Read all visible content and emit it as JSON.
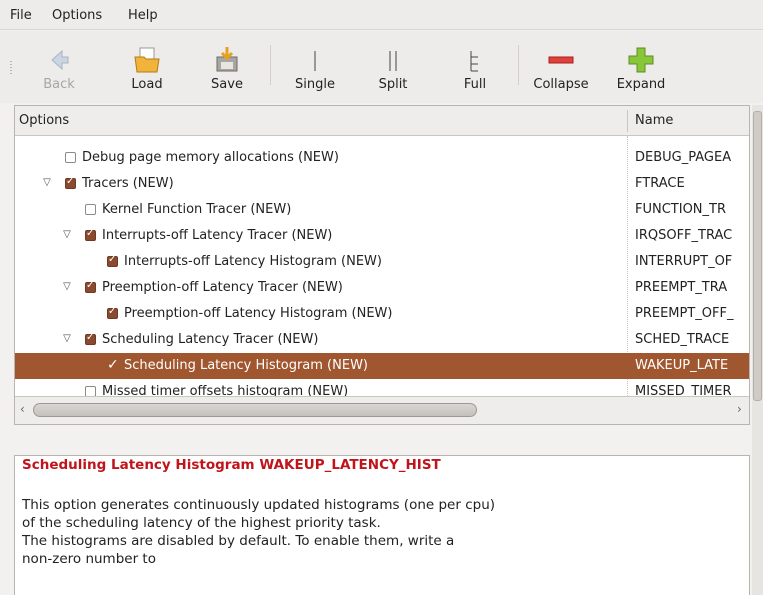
{
  "menu": {
    "file": "File",
    "options": "Options",
    "help": "Help"
  },
  "toolbar": {
    "back": "Back",
    "load": "Load",
    "save": "Save",
    "single": "Single",
    "split": "Split",
    "full": "Full",
    "collapse": "Collapse",
    "expand": "Expand"
  },
  "tree": {
    "headers": {
      "options": "Options",
      "name": "Name"
    },
    "rows": [
      {
        "label": "Debug page memory allocations (NEW)",
        "name": "DEBUG_PAGEA",
        "checked": false,
        "expander": ""
      },
      {
        "label": "Tracers (NEW)",
        "name": "FTRACE",
        "checked": true,
        "expander": "▽"
      },
      {
        "label": "Kernel Function Tracer (NEW)",
        "name": "FUNCTION_TR",
        "checked": false,
        "expander": ""
      },
      {
        "label": "Interrupts-off Latency Tracer (NEW)",
        "name": "IRQSOFF_TRAC",
        "checked": true,
        "expander": "▽"
      },
      {
        "label": "Interrupts-off Latency Histogram (NEW)",
        "name": "INTERRUPT_OF",
        "checked": true,
        "expander": ""
      },
      {
        "label": "Preemption-off Latency Tracer (NEW)",
        "name": "PREEMPT_TRA",
        "checked": true,
        "expander": "▽"
      },
      {
        "label": "Preemption-off Latency Histogram (NEW)",
        "name": "PREEMPT_OFF_",
        "checked": true,
        "expander": ""
      },
      {
        "label": "Scheduling Latency Tracer (NEW)",
        "name": "SCHED_TRACE",
        "checked": true,
        "expander": "▽"
      },
      {
        "label": "Scheduling Latency Histogram (NEW)",
        "name": "WAKEUP_LATE",
        "checked": true,
        "expander": "",
        "selected": true
      },
      {
        "label": "Missed timer offsets histogram (NEW)",
        "name": "MISSED_TIMER",
        "checked": false,
        "expander": ""
      }
    ]
  },
  "description": {
    "title": "Scheduling Latency Histogram WAKEUP_LATENCY_HIST",
    "lines": [
      "This option generates continuously updated histograms (one per cpu)",
      "of the scheduling latency of the highest priority task.",
      "The histograms are disabled by default. To enable them, write a",
      "non-zero number to"
    ]
  },
  "colors": {
    "selection": "#a0562e",
    "checkbox_on": "#8a4a2f",
    "desc_title": "#c0141a"
  }
}
